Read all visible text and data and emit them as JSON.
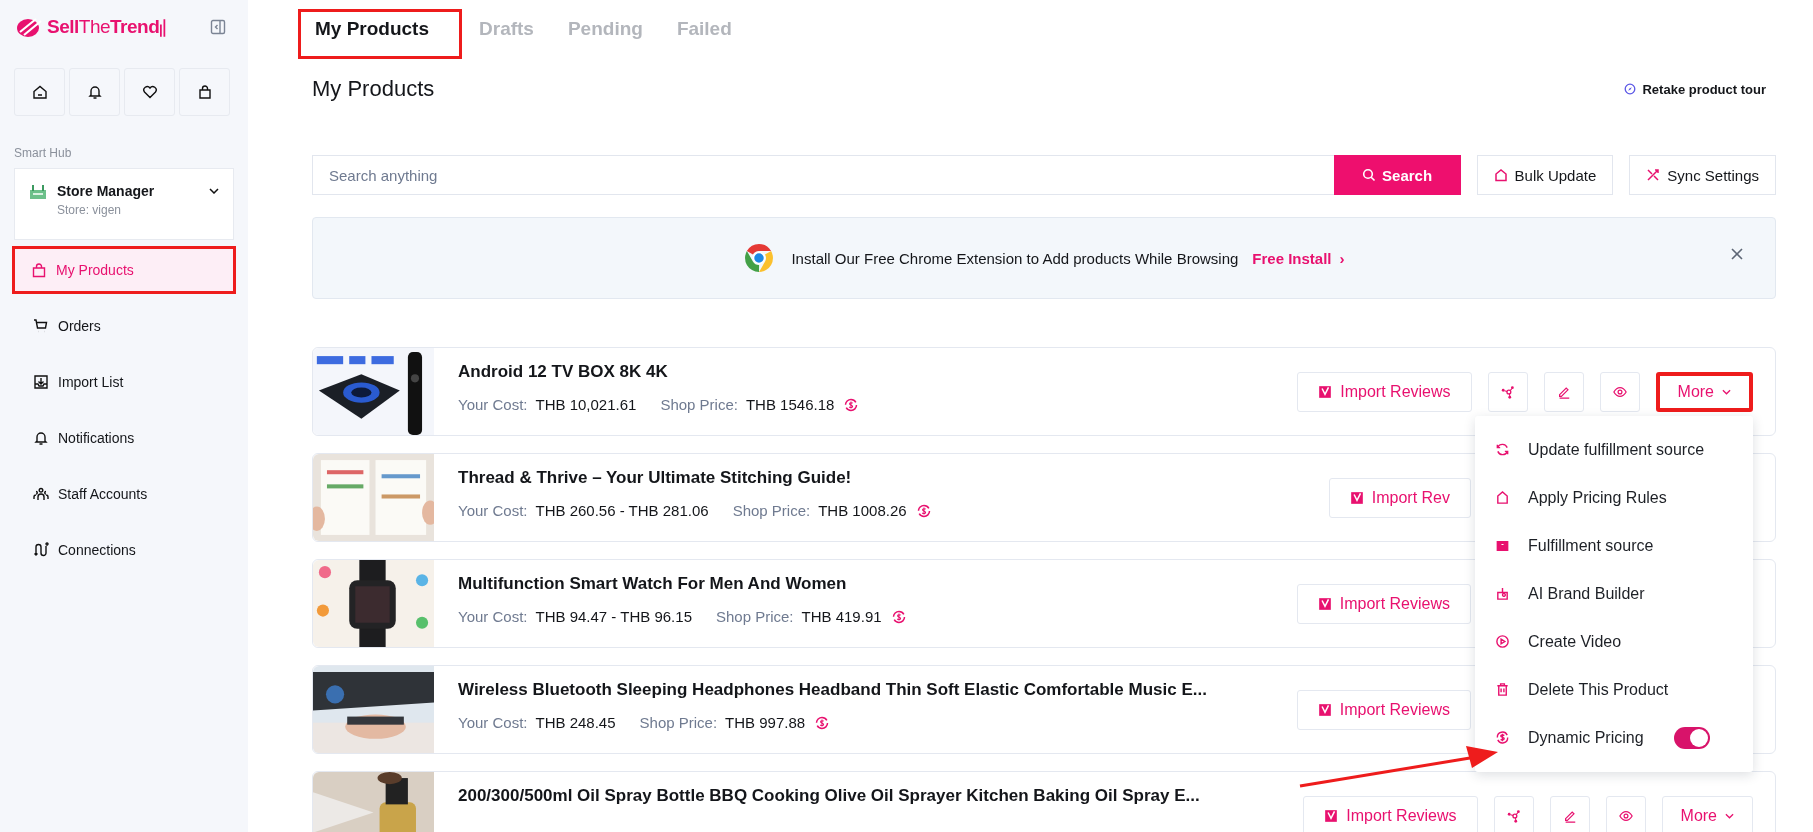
{
  "sidebar": {
    "logo": [
      {
        "text": "Sell",
        "kind": "strong"
      },
      {
        "text": "The",
        "kind": "light"
      },
      {
        "text": "Trend",
        "kind": "strong"
      }
    ],
    "quick_buttons": [
      {
        "kind": "home"
      },
      {
        "kind": "bell"
      },
      {
        "kind": "heart"
      },
      {
        "kind": "bag"
      }
    ],
    "section_label": "Smart Hub",
    "store": {
      "title": "Store Manager",
      "subtitle": "Store: vigen"
    },
    "items": [
      {
        "label": "My Products",
        "kind": "bag",
        "selected": true,
        "highlighted": true
      },
      {
        "label": "Orders",
        "kind": "cart",
        "selected": false,
        "highlighted": false
      },
      {
        "label": "Import List",
        "kind": "import",
        "selected": false,
        "highlighted": false
      },
      {
        "label": "Notifications",
        "kind": "bell",
        "selected": false,
        "highlighted": false
      },
      {
        "label": "Staff Accounts",
        "kind": "people",
        "selected": false,
        "highlighted": false
      },
      {
        "label": "Connections",
        "kind": "route",
        "selected": false,
        "highlighted": false
      }
    ]
  },
  "tabs": [
    {
      "label": "My Products",
      "selected": true,
      "highlighted": true
    },
    {
      "label": "Drafts",
      "selected": false,
      "highlighted": false
    },
    {
      "label": "Pending",
      "selected": false,
      "highlighted": false
    },
    {
      "label": "Failed",
      "selected": false,
      "highlighted": false
    }
  ],
  "page_title": "My Products",
  "tour_link": "Retake product tour",
  "search": {
    "placeholder": "Search anything",
    "button": "Search"
  },
  "toolbar_buttons": [
    {
      "kind": "bulk",
      "label": "Bulk Update"
    },
    {
      "kind": "sync",
      "label": "Sync Settings"
    }
  ],
  "banner": {
    "text": "Install Our Free Chrome Extension to Add products While Browsing",
    "link": "Free Install",
    "link_arrow": "›"
  },
  "products": [
    {
      "title": "Android 12 TV BOX 8K 4K",
      "cost_label": "Your Cost:",
      "cost": "THB 10,021.61",
      "price_label": "Shop Price:",
      "price": "THB 1546.18",
      "dynamic": true,
      "buttons": [
        {
          "kind": "import",
          "label": "Import Reviews"
        },
        {
          "kind": "connect"
        },
        {
          "kind": "edit"
        },
        {
          "kind": "view"
        },
        {
          "kind": "more",
          "label": "More",
          "highlighted": true,
          "menu": [
            {
              "label": "Update fulfillment source",
              "kind": "action"
            },
            {
              "label": "Apply Pricing Rules",
              "kind": "action"
            },
            {
              "label": "Fulfillment source",
              "kind": "action"
            },
            {
              "label": "AI Brand Builder",
              "kind": "action"
            },
            {
              "label": "Create Video",
              "kind": "action"
            },
            {
              "label": "Delete This Product",
              "kind": "action"
            },
            {
              "label": "Dynamic Pricing",
              "kind": "toggle",
              "on": true
            }
          ]
        }
      ]
    },
    {
      "title": "Thread & Thrive – Your Ultimate Stitching Guide!",
      "cost_label": "Your Cost:",
      "cost": "THB 260.56 - THB 281.06",
      "price_label": "Shop Price:",
      "price": "THB 1008.26",
      "dynamic": true,
      "buttons": [
        {
          "kind": "import",
          "label": "Import Rev"
        }
      ]
    },
    {
      "title": "Multifunction Smart Watch For Men And Women",
      "cost_label": "Your Cost:",
      "cost": "THB 94.47 - THB 96.15",
      "price_label": "Shop Price:",
      "price": "THB 419.91",
      "dynamic": true,
      "buttons": [
        {
          "kind": "import",
          "label": "Import Reviews"
        }
      ]
    },
    {
      "title": "Wireless Bluetooth Sleeping Headphones Headband Thin Soft Elastic Comfortable Music E...",
      "cost_label": "Your Cost:",
      "cost": "THB 248.45",
      "price_label": "Shop Price:",
      "price": "THB 997.88",
      "dynamic": true,
      "buttons": [
        {
          "kind": "import",
          "label": "Import Reviews"
        }
      ]
    },
    {
      "title": "200/300/500ml Oil Spray Bottle BBQ Cooking Olive Oil Sprayer Kitchen Baking Oil Spray E...",
      "buttons": [
        {
          "kind": "import",
          "label": "Import Reviews"
        },
        {
          "kind": "connect"
        },
        {
          "kind": "edit"
        },
        {
          "kind": "view"
        },
        {
          "kind": "more",
          "label": "More",
          "highlighted": false
        }
      ]
    }
  ],
  "annotation_arrow": true
}
